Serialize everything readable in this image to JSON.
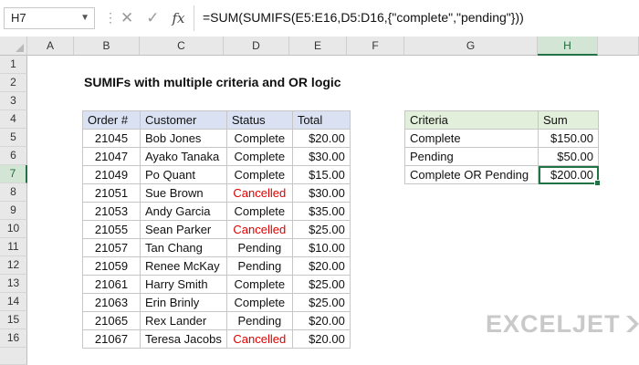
{
  "formula_bar": {
    "name_box": "H7",
    "formula": "=SUM(SUMIFS(E5:E16,D5:D16,{\"complete\",\"pending\"}))",
    "fx_label": "fx"
  },
  "columns": [
    "A",
    "B",
    "C",
    "D",
    "E",
    "F",
    "G",
    "H"
  ],
  "selected_column": "H",
  "rows": [
    "1",
    "2",
    "3",
    "4",
    "5",
    "6",
    "7",
    "8",
    "9",
    "10",
    "11",
    "12",
    "13",
    "14",
    "15",
    "16"
  ],
  "selected_row": "7",
  "sheet_title": "SUMIFs with multiple criteria and OR logic",
  "orders_table": {
    "headers": [
      "Order #",
      "Customer",
      "Status",
      "Total"
    ],
    "rows": [
      {
        "order": "21045",
        "customer": "Bob Jones",
        "status": "Complete",
        "total": "$20.00"
      },
      {
        "order": "21047",
        "customer": "Ayako Tanaka",
        "status": "Complete",
        "total": "$30.00"
      },
      {
        "order": "21049",
        "customer": "Po Quant",
        "status": "Complete",
        "total": "$15.00"
      },
      {
        "order": "21051",
        "customer": "Sue Brown",
        "status": "Cancelled",
        "total": "$30.00"
      },
      {
        "order": "21053",
        "customer": "Andy Garcia",
        "status": "Complete",
        "total": "$35.00"
      },
      {
        "order": "21055",
        "customer": "Sean Parker",
        "status": "Cancelled",
        "total": "$25.00"
      },
      {
        "order": "21057",
        "customer": "Tan Chang",
        "status": "Pending",
        "total": "$10.00"
      },
      {
        "order": "21059",
        "customer": "Renee McKay",
        "status": "Pending",
        "total": "$20.00"
      },
      {
        "order": "21061",
        "customer": "Harry Smith",
        "status": "Complete",
        "total": "$25.00"
      },
      {
        "order": "21063",
        "customer": "Erin Brinly",
        "status": "Complete",
        "total": "$25.00"
      },
      {
        "order": "21065",
        "customer": "Rex Lander",
        "status": "Pending",
        "total": "$20.00"
      },
      {
        "order": "21067",
        "customer": "Teresa Jacobs",
        "status": "Cancelled",
        "total": "$20.00"
      }
    ]
  },
  "criteria_table": {
    "headers": [
      "Criteria",
      "Sum"
    ],
    "rows": [
      {
        "criteria": "Complete",
        "sum": "$150.00"
      },
      {
        "criteria": "Pending",
        "sum": "$50.00"
      },
      {
        "criteria": "Complete OR Pending",
        "sum": "$200.00"
      }
    ]
  },
  "colors": {
    "cancelled_text": "#e00000",
    "orders_header_bg": "#d9e1f2",
    "criteria_header_bg": "#e2efda",
    "selection": "#217346"
  },
  "branding": {
    "logo_text": "EXCELJET"
  }
}
